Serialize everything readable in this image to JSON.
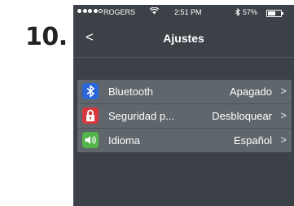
{
  "step_label": "10.",
  "status_bar": {
    "carrier": "ROGERS",
    "wifi_glyph": "≈",
    "time": "2:51 PM",
    "bluetooth_glyph": "✱",
    "battery": "57%",
    "battery_level": 0.57
  },
  "nav": {
    "back_glyph": "<",
    "title": "Ajustes"
  },
  "settings": [
    {
      "icon": "bluetooth-icon",
      "icon_color": "#2b66d9",
      "label": "Bluetooth",
      "value": "Apagado",
      "chevron": ">"
    },
    {
      "icon": "lock-icon",
      "icon_color": "#d8373d",
      "label": "Seguridad p...",
      "value": "Desbloquear",
      "chevron": ">"
    },
    {
      "icon": "speaker-icon",
      "icon_color": "#52b54a",
      "label": "Idioma",
      "value": "Español",
      "chevron": ">"
    }
  ]
}
